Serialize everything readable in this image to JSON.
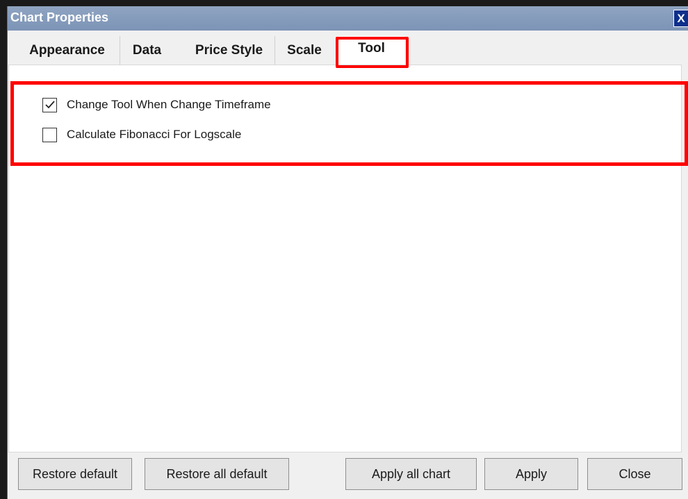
{
  "window": {
    "title": "Chart Properties",
    "close_label": "X"
  },
  "tabs": [
    {
      "label": "Appearance",
      "active": false
    },
    {
      "label": "Data",
      "active": false
    },
    {
      "label": "Price Style",
      "active": false
    },
    {
      "label": "Scale",
      "active": false
    },
    {
      "label": "Tool",
      "active": true
    }
  ],
  "tool_options": [
    {
      "label": "Change Tool When Change Timeframe",
      "checked": true
    },
    {
      "label": "Calculate Fibonacci For Logscale",
      "checked": false
    }
  ],
  "footer": {
    "restore_default": "Restore default",
    "restore_all_default": "Restore all default",
    "apply_all_chart": "Apply all chart",
    "apply": "Apply",
    "close": "Close"
  },
  "colors": {
    "highlight": "#ff0000",
    "titlebar": "#7c94b6",
    "close_button": "#0d2f8c"
  }
}
